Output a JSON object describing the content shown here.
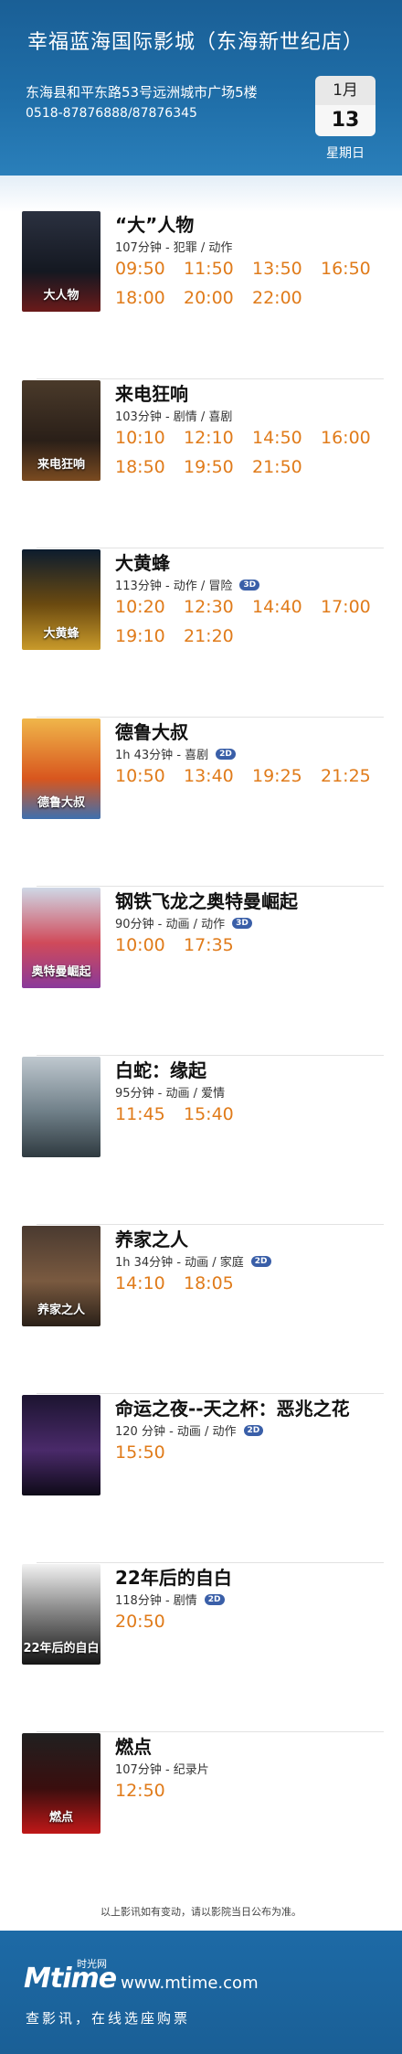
{
  "header": {
    "cinema_title": "幸福蓝海国际影城（东海新世纪店）",
    "address": "东海县和平东路53号远洲城市广场5楼",
    "phone": "0518-87876888/87876345",
    "calendar": {
      "month": "1月",
      "day": "13",
      "weekday": "星期日"
    }
  },
  "movies": [
    {
      "title": "“大”人物",
      "meta": "107分钟 - 犯罪 / 动作",
      "badge": "",
      "poster_text": "大人物",
      "times": [
        "09:50",
        "11:50",
        "13:50",
        "16:50",
        "18:00",
        "20:00",
        "22:00"
      ]
    },
    {
      "title": "来电狂响",
      "meta": "103分钟 - 剧情 / 喜剧",
      "badge": "",
      "poster_text": "来电狂响",
      "times": [
        "10:10",
        "12:10",
        "14:50",
        "16:00",
        "18:50",
        "19:50",
        "21:50"
      ]
    },
    {
      "title": "大黄蜂",
      "meta": "113分钟 - 动作 / 冒险",
      "badge": "3D",
      "poster_text": "大黄蜂",
      "times": [
        "10:20",
        "12:30",
        "14:40",
        "17:00",
        "19:10",
        "21:20"
      ]
    },
    {
      "title": "德鲁大叔",
      "meta": "1h 43分钟 - 喜剧",
      "badge": "2D",
      "poster_text": "德鲁大叔",
      "times": [
        "10:50",
        "13:40",
        "19:25",
        "21:25"
      ]
    },
    {
      "title": "钢铁飞龙之奥特曼崛起",
      "meta": "90分钟 - 动画 / 动作",
      "badge": "3D",
      "poster_text": "奥特曼崛起",
      "times": [
        "10:00",
        "17:35"
      ]
    },
    {
      "title": "白蛇：缘起",
      "meta": "95分钟 - 动画 / 爱情",
      "badge": "",
      "poster_text": "",
      "times": [
        "11:45",
        "15:40"
      ]
    },
    {
      "title": "养家之人",
      "meta": "1h 34分钟 - 动画 / 家庭",
      "badge": "2D",
      "poster_text": "养家之人",
      "times": [
        "14:10",
        "18:05"
      ]
    },
    {
      "title": "命运之夜--天之杯：恶兆之花",
      "meta": "120 分钟 - 动画 / 动作",
      "badge": "2D",
      "poster_text": "",
      "times": [
        "15:50"
      ]
    },
    {
      "title": "22年后的自白",
      "meta": "118分钟 - 剧情",
      "badge": "2D",
      "poster_text": "22年后的自白",
      "times": [
        "20:50"
      ]
    },
    {
      "title": "燃点",
      "meta": "107分钟 - 纪录片",
      "badge": "",
      "poster_text": "燃点",
      "times": [
        "12:50"
      ]
    }
  ],
  "posters": [
    {
      "bg": "linear-gradient(180deg,#2b3140 0%,#141821 60%,#6b1a1a 100%)"
    },
    {
      "bg": "linear-gradient(180deg,#4a3a2a 0%,#2a1f18 60%,#7a4a20 100%)"
    },
    {
      "bg": "linear-gradient(180deg,#0c1c2e 0%,#6b4a10 55%,#c99a2a 100%)"
    },
    {
      "bg": "linear-gradient(180deg,#f0b64a 0%,#d8561e 60%,#3e6fae 100%)"
    },
    {
      "bg": "linear-gradient(180deg,#cfd8e6 0%,#d04a5a 55%,#8a3a9a 100%)"
    },
    {
      "bg": "linear-gradient(180deg,#bfc8cf 0%,#6f7f88 55%,#2f3a40 100%)"
    },
    {
      "bg": "linear-gradient(180deg,#4a3a30 0%,#7a5a40 55%,#2a2018 100%)"
    },
    {
      "bg": "linear-gradient(180deg,#1c1430 0%,#4a2a6a 55%,#0e0a18 100%)"
    },
    {
      "bg": "linear-gradient(180deg,#f2f2f2 0%,#8a8a8a 45%,#151515 100%)"
    },
    {
      "bg": "linear-gradient(180deg,#202020 0%,#3a0e0e 55%,#c01818 100%)"
    }
  ],
  "footer": {
    "note": "以上影讯如有变动，请以影院当日公布为准。",
    "logo": "Mtime",
    "logo_cn": "时光网",
    "url": "www.mtime.com",
    "tagline": "查影讯，在线选座购票"
  },
  "colors": {
    "header_blue": "#1f6ea8",
    "showtime_orange": "#e07b1a",
    "badge_blue": "#3a5fa8"
  }
}
